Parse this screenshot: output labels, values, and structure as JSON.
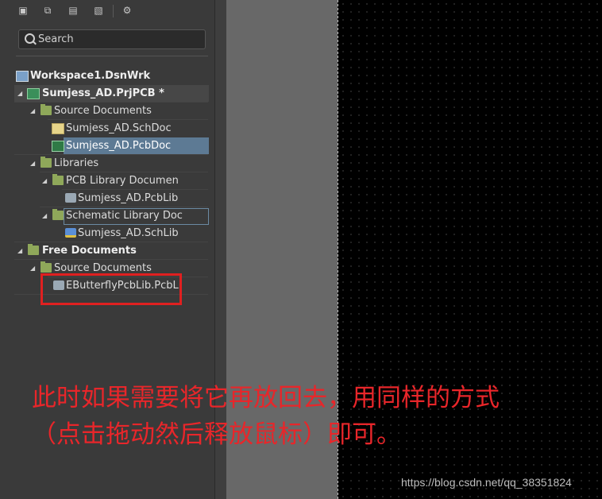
{
  "toolbar": {
    "icons": [
      "save-icon",
      "save-all-icon",
      "close-project-icon",
      "open-folder-icon",
      "gear-icon"
    ]
  },
  "search": {
    "placeholder": "Search"
  },
  "tree": {
    "workspace": "Workspace1.DsnWrk",
    "project": "Sumjess_AD.PrjPCB *",
    "source_documents": "Source Documents",
    "schdoc": "Sumjess_AD.SchDoc",
    "pcbdoc": "Sumjess_AD.PcbDoc",
    "libraries": "Libraries",
    "pcb_lib_folder": "PCB Library Documen",
    "pcblib": "Sumjess_AD.PcbLib",
    "sch_lib_folder": "Schematic Library Doc",
    "schlib": "Sumjess_AD.SchLib",
    "free_documents": "Free Documents",
    "free_source_documents": "Source Documents",
    "free_pcblib": "EButterflyPcbLib.PcbLi"
  },
  "annotation": {
    "line1": "此时如果需要将它再放回去，用同样的方式",
    "line2": "（点击拖动然后释放鼠标）即可。",
    "color": "#e8262a"
  },
  "watermark": "https://blog.csdn.net/qq_38351824"
}
